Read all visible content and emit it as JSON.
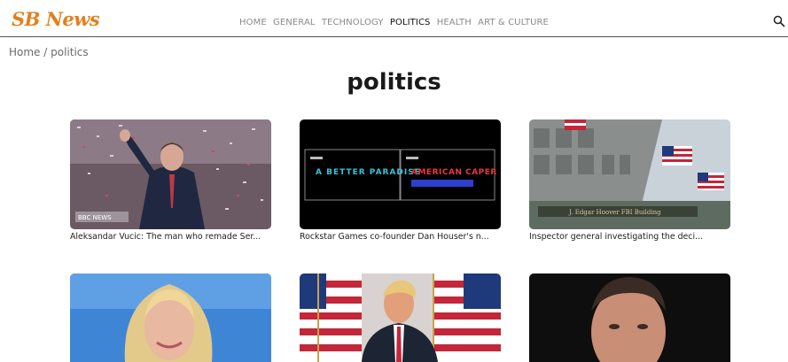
{
  "site": {
    "logo_text": "SB News"
  },
  "nav": {
    "items": [
      {
        "label": "HOME",
        "active": false
      },
      {
        "label": "GENERAL",
        "active": false
      },
      {
        "label": "TECHNOLOGY",
        "active": false
      },
      {
        "label": "POLITICS",
        "active": true
      },
      {
        "label": "HEALTH",
        "active": false
      },
      {
        "label": "ART & CULTURE",
        "active": false
      }
    ],
    "search_icon": "search-icon"
  },
  "breadcrumb": {
    "text": "Home / politics"
  },
  "page": {
    "title": "politics"
  },
  "articles": [
    {
      "caption": "Aleksandar Vucic: The man who remade Ser...",
      "image_text": "BBC NEWS"
    },
    {
      "caption": "Rockstar Games co-founder Dan Houser's n...",
      "image_text_1": "A BETTER PARADISE",
      "image_text_2": "AMERICAN CAPER"
    },
    {
      "caption": "Inspector general investigating the deci...",
      "image_text": "J. Edgar Hoover FBI Building"
    },
    {
      "caption": ""
    },
    {
      "caption": ""
    },
    {
      "caption": ""
    }
  ],
  "colors": {
    "brand": "#e2801d",
    "nav_active": "#111111",
    "nav_inactive": "#8a8a8a"
  }
}
